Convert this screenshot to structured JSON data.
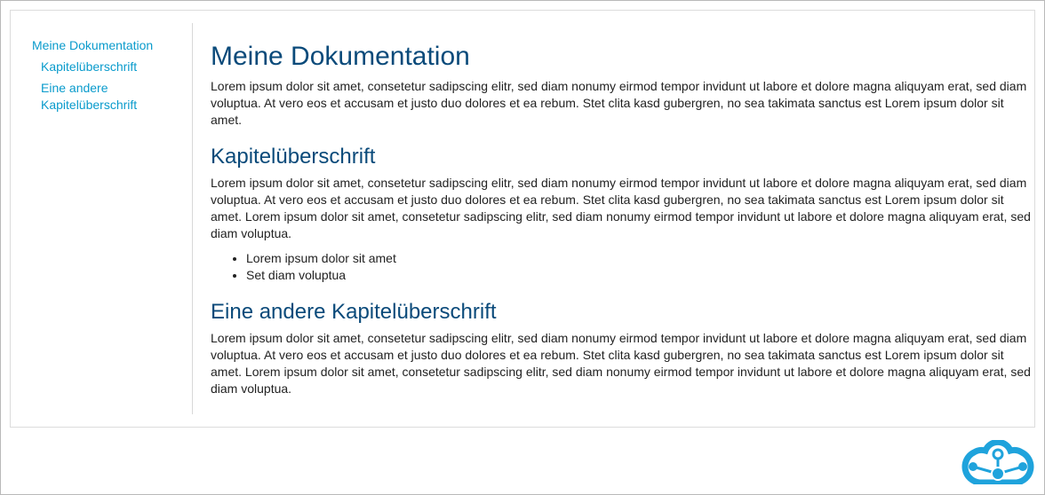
{
  "brand": {
    "color": "#1fa3dc",
    "logo": "cloud-network-logo"
  },
  "sidebar": {
    "items": [
      {
        "label": "Meine Dokumentation",
        "level": 0
      },
      {
        "label": "Kapitelüberschrift",
        "level": 1
      },
      {
        "label": "Eine andere Kapitelüberschrift",
        "level": 1
      }
    ]
  },
  "main": {
    "title": "Meine Dokumentation",
    "intro": "Lorem ipsum dolor sit amet, consetetur sadipscing elitr, sed diam nonumy eirmod tempor invidunt ut labore et dolore magna aliquyam erat, sed diam voluptua. At vero eos et accusam et justo duo dolores et ea rebum. Stet clita kasd gubergren, no sea takimata sanctus est Lorem ipsum dolor sit amet.",
    "sections": [
      {
        "heading": "Kapitelüberschrift",
        "text": "Lorem ipsum dolor sit amet, consetetur sadipscing elitr, sed diam nonumy eirmod tempor invidunt ut labore et dolore magna aliquyam erat, sed diam voluptua. At vero eos et accusam et justo duo dolores et ea rebum. Stet clita kasd gubergren, no sea takimata sanctus est Lorem ipsum dolor sit amet. Lorem ipsum dolor sit amet, consetetur sadipscing elitr, sed diam nonumy eirmod tempor invidunt ut labore et dolore magna aliquyam erat, sed diam voluptua.",
        "list": [
          "Lorem ipsum dolor sit amet",
          "Set diam voluptua"
        ]
      },
      {
        "heading": "Eine andere Kapitelüberschrift",
        "text": "Lorem ipsum dolor sit amet, consetetur sadipscing elitr, sed diam nonumy eirmod tempor invidunt ut labore et dolore magna aliquyam erat, sed diam voluptua. At vero eos et accusam et justo duo dolores et ea rebum. Stet clita kasd gubergren, no sea takimata sanctus est Lorem ipsum dolor sit amet. Lorem ipsum dolor sit amet, consetetur sadipscing elitr, sed diam nonumy eirmod tempor invidunt ut labore et dolore magna aliquyam erat, sed diam voluptua."
      }
    ]
  }
}
